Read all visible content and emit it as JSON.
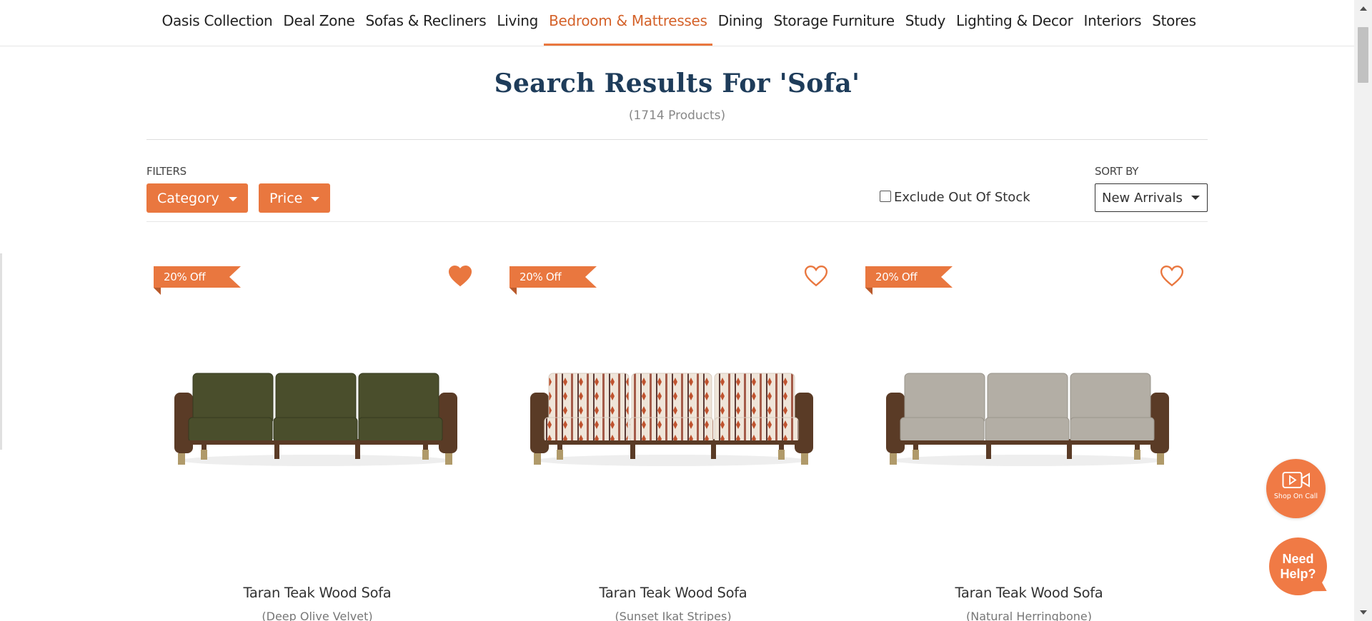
{
  "nav": {
    "items": [
      {
        "label": "Oasis Collection",
        "active": false
      },
      {
        "label": "Deal Zone",
        "active": false
      },
      {
        "label": "Sofas & Recliners",
        "active": false
      },
      {
        "label": "Living",
        "active": false
      },
      {
        "label": "Bedroom & Mattresses",
        "active": true
      },
      {
        "label": "Dining",
        "active": false
      },
      {
        "label": "Storage Furniture",
        "active": false
      },
      {
        "label": "Study",
        "active": false
      },
      {
        "label": "Lighting & Decor",
        "active": false
      },
      {
        "label": "Interiors",
        "active": false
      },
      {
        "label": "Stores",
        "active": false
      }
    ]
  },
  "search": {
    "title": "Search Results For 'Sofa'",
    "count": "(1714 Products)"
  },
  "filters": {
    "label": "FILTERS",
    "category_label": "Category",
    "price_label": "Price",
    "exclude_out_of_stock": "Exclude Out Of Stock",
    "exclude_checked": false
  },
  "sort": {
    "label": "SORT BY",
    "selected": "New Arrivals"
  },
  "products": [
    {
      "discount": "20% Off",
      "name": "Taran Teak Wood Sofa",
      "variant": "(Deep Olive Velvet)",
      "wishlisted": true,
      "upholstery": "#4a4e2c",
      "upholstery_dark": "#353a1f"
    },
    {
      "discount": "20% Off",
      "name": "Taran Teak Wood Sofa",
      "variant": "(Sunset Ikat Stripes)",
      "wishlisted": false,
      "upholstery": "#efe5d9",
      "upholstery_dark": "#a45a48"
    },
    {
      "discount": "20% Off",
      "name": "Taran Teak Wood Sofa",
      "variant": "(Natural Herringbone)",
      "wishlisted": false,
      "upholstery": "#b3aea5",
      "upholstery_dark": "#9a958c"
    }
  ],
  "floating": {
    "shop_on_call": "Shop On Call",
    "need_help": "Need Help?"
  },
  "colors": {
    "accent": "#e9773f",
    "title": "#1e3c5a",
    "wood": "#5a3b26",
    "brass": "#b09a6a"
  },
  "icons": {
    "wishlist": "heart-icon",
    "shop_on_call": "video-call-icon",
    "dropdown": "caret-down-icon"
  }
}
